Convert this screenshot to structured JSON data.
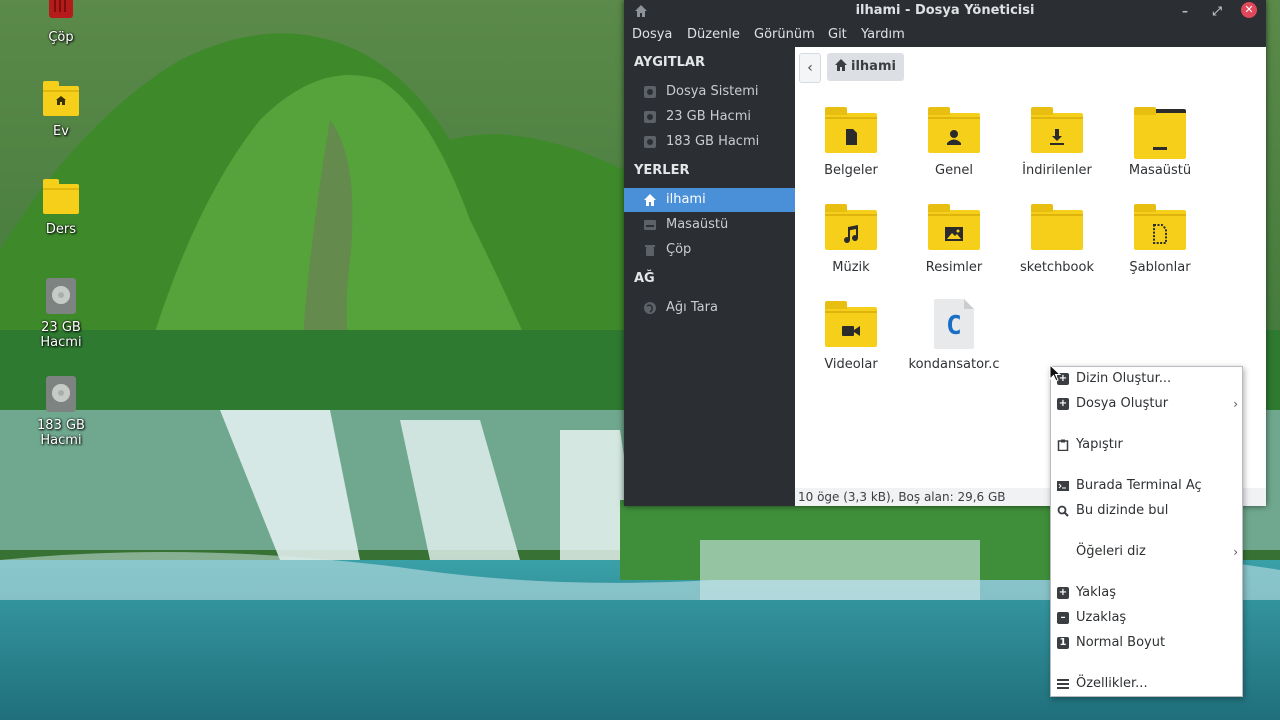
{
  "desktop": {
    "icons": [
      {
        "label": "Çöp",
        "icon": "trash-icon"
      },
      {
        "label": "Ev",
        "icon": "home-folder-icon"
      },
      {
        "label": "Ders",
        "icon": "folder-icon"
      },
      {
        "label": "23 GB Hacmi",
        "icon": "drive-icon"
      },
      {
        "label": "183 GB Hacmi",
        "icon": "drive-icon"
      }
    ]
  },
  "window": {
    "title": "ilhami - Dosya Yöneticisi",
    "menu": [
      "Dosya",
      "Düzenle",
      "Görünüm",
      "Git",
      "Yardım"
    ]
  },
  "sidebar": {
    "devices_heading": "AYGITLAR",
    "devices": [
      "Dosya Sistemi",
      "23 GB Hacmi",
      "183 GB Hacmi"
    ],
    "places_heading": "YERLER",
    "places": [
      "ilhami",
      "Masaüstü",
      "Çöp"
    ],
    "network_heading": "AĞ",
    "network": [
      "Ağı Tara"
    ]
  },
  "pathbar": {
    "current": "ilhami"
  },
  "files": [
    {
      "name": "Belgeler",
      "icon": "documents-folder-icon"
    },
    {
      "name": "Genel",
      "icon": "public-folder-icon"
    },
    {
      "name": "İndirilenler",
      "icon": "downloads-folder-icon"
    },
    {
      "name": "Masaüstü",
      "icon": "desktop-folder-icon"
    },
    {
      "name": "Müzik",
      "icon": "music-folder-icon"
    },
    {
      "name": "Resimler",
      "icon": "pictures-folder-icon"
    },
    {
      "name": "sketchbook",
      "icon": "folder-icon"
    },
    {
      "name": "Şablonlar",
      "icon": "templates-folder-icon"
    },
    {
      "name": "Videolar",
      "icon": "videos-folder-icon"
    },
    {
      "name": "kondansator.c",
      "icon": "c-source-file-icon"
    }
  ],
  "status": "10 öge (3,3 kB), Boş alan: 29,6 GB",
  "context_menu": {
    "items": [
      {
        "label": "Dizin Oluştur...",
        "icon": "new-folder-icon"
      },
      {
        "label": "Dosya Oluştur",
        "icon": "new-file-icon",
        "submenu": true
      },
      {
        "label": "Yapıştır",
        "icon": "paste-icon"
      },
      {
        "label": "Burada Terminal Aç",
        "icon": "terminal-icon"
      },
      {
        "label": "Bu dizinde bul",
        "icon": "search-icon"
      },
      {
        "label": "Öğeleri diz",
        "icon": "",
        "submenu": true
      },
      {
        "label": "Yaklaş",
        "icon": "zoom-in-icon"
      },
      {
        "label": "Uzaklaş",
        "icon": "zoom-out-icon"
      },
      {
        "label": "Normal Boyut",
        "icon": "zoom-reset-icon"
      },
      {
        "label": "Özellikler...",
        "icon": "properties-icon"
      }
    ]
  },
  "colors": {
    "accent": "#4a90d9",
    "folder": "#f6cf1a",
    "close": "#e0475b"
  }
}
